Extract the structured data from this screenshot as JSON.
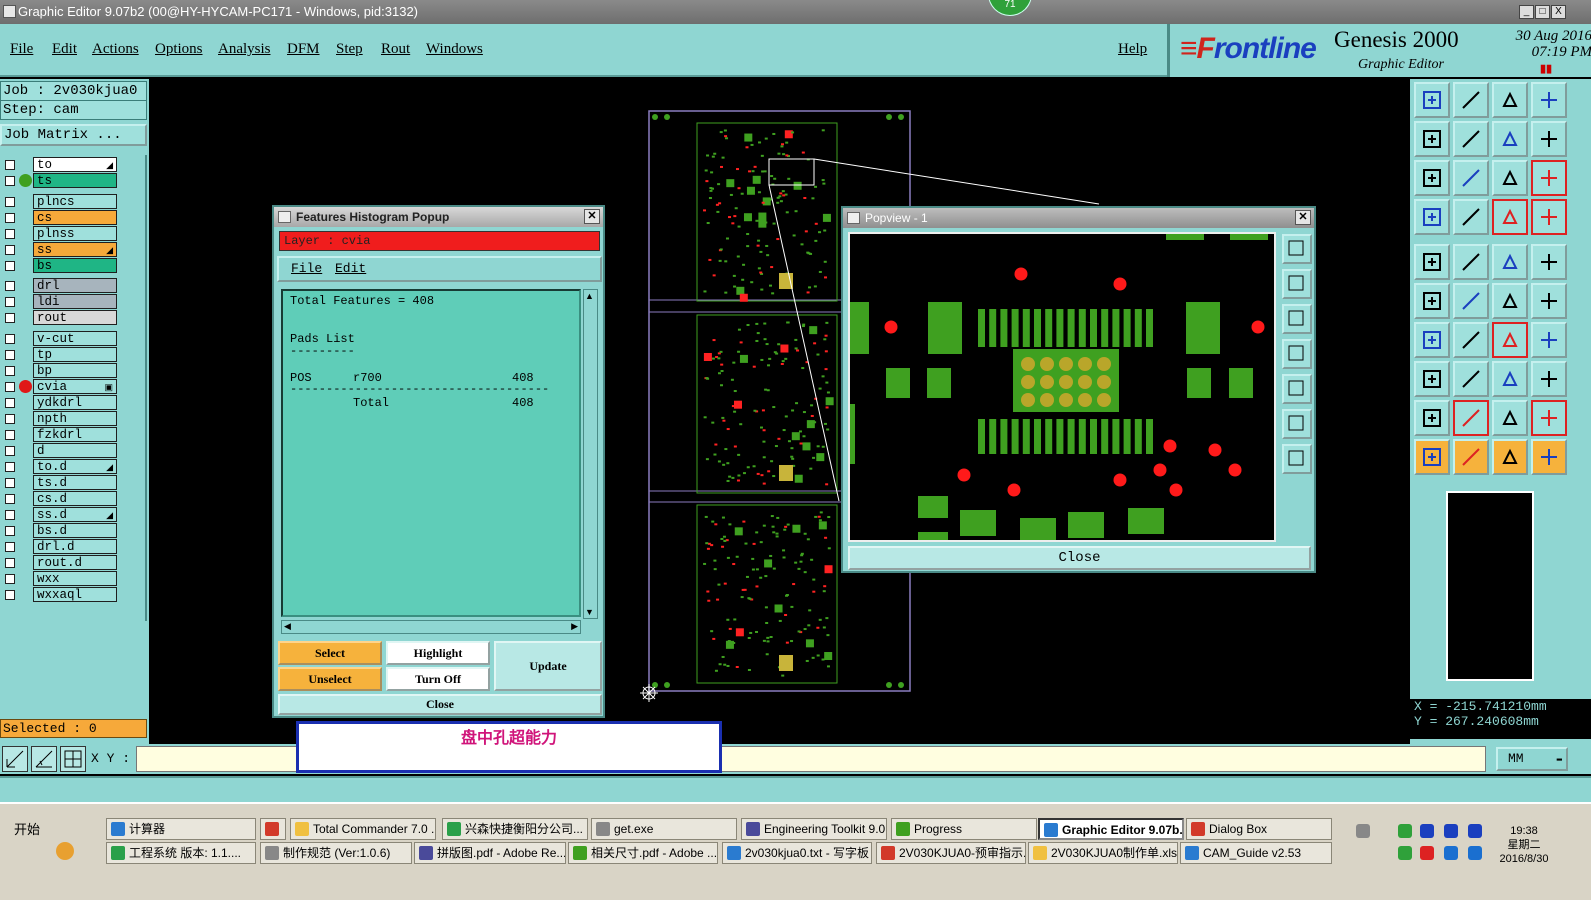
{
  "window": {
    "title": "Graphic Editor 9.07b2 (00@HY-HYCAM-PC171 - Windows, pid:3132)",
    "badge": "71",
    "min": "_",
    "max": "□",
    "close": "X"
  },
  "menu": {
    "items": [
      "File",
      "Edit",
      "Actions",
      "Options",
      "Analysis",
      "DFM",
      "Step",
      "Rout",
      "Windows"
    ],
    "help": "Help"
  },
  "brand": {
    "logo_f": "≡F",
    "logo_rest": "rontline",
    "product": "Genesis 2000",
    "subtitle": "Graphic Editor",
    "date": "30 Aug 2016",
    "time": "07:19 PM",
    "pause": "▮▮"
  },
  "left": {
    "job": "Job : 2v030kjua0",
    "step": "Step: cam",
    "job_matrix": "Job Matrix ...",
    "layers": [
      {
        "name": "to",
        "color": "#ffffff",
        "flag": "◢",
        "dot": ""
      },
      {
        "name": "ts",
        "color": "#1fb585",
        "flag": "",
        "dot": "#3fa020"
      },
      {
        "name": "plncs",
        "color": "#9fe0dc",
        "flag": "",
        "dot": ""
      },
      {
        "name": "cs",
        "color": "#f6a93a",
        "flag": "",
        "dot": ""
      },
      {
        "name": "plnss",
        "color": "#9fe0dc",
        "flag": "",
        "dot": ""
      },
      {
        "name": "ss",
        "color": "#f6a93a",
        "flag": "◢",
        "dot": ""
      },
      {
        "name": "bs",
        "color": "#1fb585",
        "flag": "",
        "dot": ""
      },
      {
        "name": "drl",
        "color": "#a7b4bd",
        "flag": "",
        "dot": ""
      },
      {
        "name": "ldi",
        "color": "#a7b4bd",
        "flag": "",
        "dot": ""
      },
      {
        "name": "rout",
        "color": "#d8d8d8",
        "flag": "",
        "dot": ""
      },
      {
        "name": "v-cut",
        "color": "#9fe0dc",
        "flag": "",
        "dot": ""
      },
      {
        "name": "tp",
        "color": "#9fe0dc",
        "flag": "",
        "dot": ""
      },
      {
        "name": "bp",
        "color": "#9fe0dc",
        "flag": "",
        "dot": ""
      },
      {
        "name": "cvia",
        "color": "#9fe0dc",
        "flag": "▣",
        "dot": "#e01818"
      },
      {
        "name": "ydkdrl",
        "color": "#9fe0dc",
        "flag": "",
        "dot": ""
      },
      {
        "name": "npth",
        "color": "#9fe0dc",
        "flag": "",
        "dot": ""
      },
      {
        "name": "fzkdrl",
        "color": "#9fe0dc",
        "flag": "",
        "dot": ""
      },
      {
        "name": "d",
        "color": "#9fe0dc",
        "flag": "",
        "dot": ""
      },
      {
        "name": "to.d",
        "color": "#9fe0dc",
        "flag": "◢",
        "dot": ""
      },
      {
        "name": "ts.d",
        "color": "#9fe0dc",
        "flag": "",
        "dot": ""
      },
      {
        "name": "cs.d",
        "color": "#9fe0dc",
        "flag": "",
        "dot": ""
      },
      {
        "name": "ss.d",
        "color": "#9fe0dc",
        "flag": "◢",
        "dot": ""
      },
      {
        "name": "bs.d",
        "color": "#9fe0dc",
        "flag": "",
        "dot": ""
      },
      {
        "name": "drl.d",
        "color": "#9fe0dc",
        "flag": "",
        "dot": ""
      },
      {
        "name": "rout.d",
        "color": "#9fe0dc",
        "flag": "",
        "dot": ""
      },
      {
        "name": "wxx",
        "color": "#9fe0dc",
        "flag": "",
        "dot": ""
      },
      {
        "name": "wxxaql",
        "color": "#9fe0dc",
        "flag": "",
        "dot": ""
      }
    ],
    "selected": "Selected : 0"
  },
  "histogram": {
    "title": "Features Histogram Popup",
    "layer": "Layer :  cvia",
    "menu_file": "File",
    "menu_edit": "Edit",
    "total_features": "Total Features = 408",
    "pads_list": "Pads List",
    "pads_rule": "---------",
    "row_pos": "POS",
    "row_sym": "r700",
    "row_count": "408",
    "rule": "------------------------------------",
    "total_label": "Total",
    "total_count": "408",
    "btn_select": "Select",
    "btn_highlight": "Highlight",
    "btn_update": "Update",
    "btn_unselect": "Unselect",
    "btn_turnoff": "Turn Off",
    "btn_close": "Close"
  },
  "popview": {
    "title": "Popview - 1",
    "close": "Close"
  },
  "coords": {
    "x": "X = -215.741210mm",
    "y": "Y =  267.240608mm"
  },
  "cmd": {
    "xy_label": "X Y :",
    "input_value": "",
    "units": "MM"
  },
  "annotation": "盘中孔超能力",
  "taskbar": {
    "start": "开始",
    "row1": [
      "计算器",
      "",
      "Total Commander 7.0 ...",
      "兴森快捷衡阳分公司...",
      "get.exe",
      "Engineering Toolkit 9.0...",
      "Progress",
      "Graphic Editor 9.07b...",
      "Dialog Box"
    ],
    "row2": [
      "工程系统  版本: 1.1....",
      "制作规范 (Ver:1.0.6)",
      "拼版图.pdf - Adobe Re...",
      "相关尺寸.pdf - Adobe ...",
      "2v030kjua0.txt - 写字板",
      "2V030KJUA0-预审指示...",
      "2V030KJUA0制作单.xls...",
      "CAM_Guide v2.53"
    ],
    "clock_time": "19:38",
    "clock_day": "星期二",
    "clock_date": "2016/8/30"
  }
}
